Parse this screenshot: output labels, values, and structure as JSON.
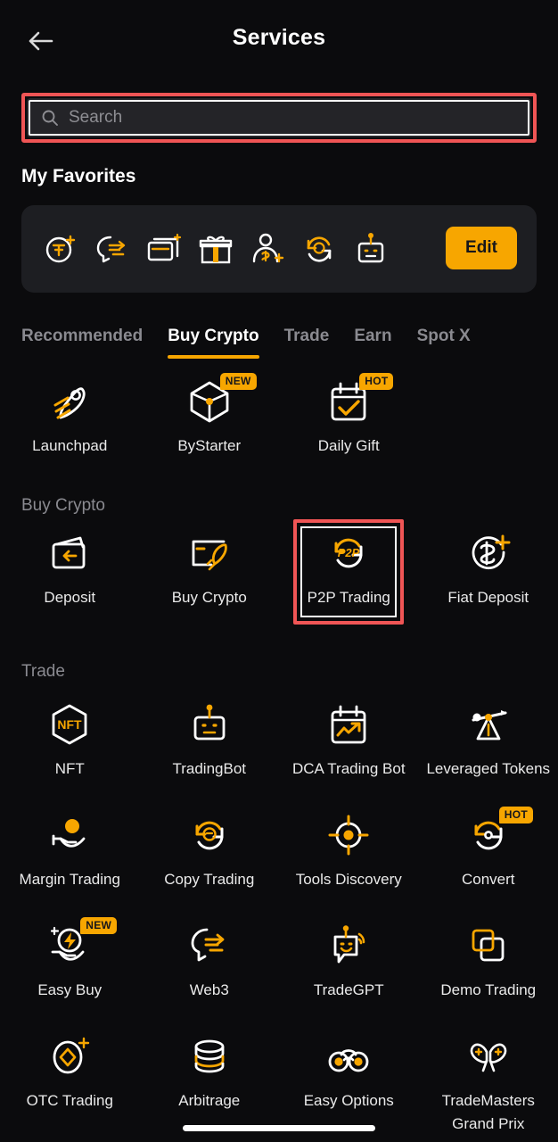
{
  "theme": {
    "background": "#0b0b0d",
    "card": "#1d1e22",
    "accent": "#f7a600",
    "annotation": "#f05555",
    "text_primary": "#ffffff",
    "text_secondary": "#8a8a90"
  },
  "header": {
    "title": "Services",
    "back_icon": "back-arrow-icon"
  },
  "search": {
    "placeholder": "Search",
    "value": "",
    "icon": "search-icon",
    "highlighted": true
  },
  "favorites": {
    "title": "My Favorites",
    "edit_label": "Edit",
    "items": [
      {
        "icon": "coin-sparkle-icon"
      },
      {
        "icon": "web3-head-icon"
      },
      {
        "icon": "card-sparkle-icon"
      },
      {
        "icon": "gift-box-icon"
      },
      {
        "icon": "referral-person-dollar-icon"
      },
      {
        "icon": "copy-trading-icon"
      },
      {
        "icon": "trading-bot-icon"
      }
    ]
  },
  "tabs": [
    {
      "label": "Recommended",
      "active": false
    },
    {
      "label": "Buy Crypto",
      "active": true
    },
    {
      "label": "Trade",
      "active": false
    },
    {
      "label": "Earn",
      "active": false
    },
    {
      "label": "Spot X",
      "active": false
    }
  ],
  "featured": [
    {
      "label": "Launchpad",
      "icon": "rocket-comet-icon",
      "badge": ""
    },
    {
      "label": "ByStarter",
      "icon": "cube-icon",
      "badge": "NEW"
    },
    {
      "label": "Daily Gift",
      "icon": "calendar-check-icon",
      "badge": "HOT"
    }
  ],
  "sections": [
    {
      "title": "Buy Crypto",
      "items": [
        {
          "label": "Deposit",
          "icon": "wallet-arrow-icon",
          "badge": "",
          "highlighted": false
        },
        {
          "label": "Buy Crypto",
          "icon": "card-rocket-icon",
          "badge": "",
          "highlighted": false
        },
        {
          "label": "P2P Trading",
          "icon": "p2p-icon",
          "badge": "",
          "highlighted": true
        },
        {
          "label": "Fiat Deposit",
          "icon": "dollar-plus-circle-icon",
          "badge": "",
          "highlighted": false
        }
      ]
    },
    {
      "title": "Trade",
      "items": [
        {
          "label": "NFT",
          "icon": "nft-hexagon-icon",
          "badge": "",
          "highlighted": false
        },
        {
          "label": "TradingBot",
          "icon": "robot-icon",
          "badge": "",
          "highlighted": false
        },
        {
          "label": "DCA Trading Bot",
          "icon": "calendar-chart-icon",
          "badge": "",
          "highlighted": false
        },
        {
          "label": "Leveraged Tokens",
          "icon": "seesaw-icon",
          "badge": "",
          "highlighted": false
        },
        {
          "label": "Margin Trading",
          "icon": "hand-coin-icon",
          "badge": "",
          "highlighted": false
        },
        {
          "label": "Copy Trading",
          "icon": "copy-trading-icon",
          "badge": "",
          "highlighted": false
        },
        {
          "label": "Tools Discovery",
          "icon": "target-icon",
          "badge": "",
          "highlighted": false
        },
        {
          "label": "Convert",
          "icon": "convert-arrows-icon",
          "badge": "HOT",
          "highlighted": false
        },
        {
          "label": "Easy Buy",
          "icon": "hand-lightning-icon",
          "badge": "NEW",
          "highlighted": false
        },
        {
          "label": "Web3",
          "icon": "web3-head-icon",
          "badge": "",
          "highlighted": false
        },
        {
          "label": "TradeGPT",
          "icon": "chat-bot-icon",
          "badge": "",
          "highlighted": false
        },
        {
          "label": "Demo Trading",
          "icon": "two-squares-icon",
          "badge": "",
          "highlighted": false
        },
        {
          "label": "OTC Trading",
          "icon": "diamond-sparkle-icon",
          "badge": "",
          "highlighted": false
        },
        {
          "label": "Arbitrage",
          "icon": "coin-stack-icon",
          "badge": "",
          "highlighted": false
        },
        {
          "label": "Easy Options",
          "icon": "binoculars-icon",
          "badge": "",
          "highlighted": false
        },
        {
          "label": "TradeMasters Grand Prix",
          "icon": "racing-flags-icon",
          "badge": "",
          "highlighted": false
        }
      ]
    }
  ]
}
